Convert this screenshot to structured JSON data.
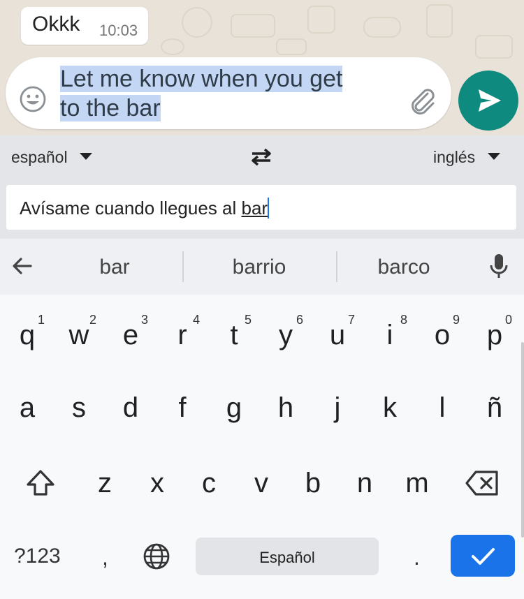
{
  "chat": {
    "message_text": "Okkk",
    "message_time": "10:03",
    "draft_line1": "Let me know when you get",
    "draft_line2": "to the bar"
  },
  "translate": {
    "source_language": "español",
    "target_language": "inglés",
    "translation_prefix": "Avísame cuando llegues al ",
    "translation_current_word": "bar"
  },
  "suggestions": [
    "bar",
    "barrio",
    "barco"
  ],
  "keyboard": {
    "row1": [
      {
        "letter": "q",
        "num": "1"
      },
      {
        "letter": "w",
        "num": "2"
      },
      {
        "letter": "e",
        "num": "3"
      },
      {
        "letter": "r",
        "num": "4"
      },
      {
        "letter": "t",
        "num": "5"
      },
      {
        "letter": "y",
        "num": "6"
      },
      {
        "letter": "u",
        "num": "7"
      },
      {
        "letter": "i",
        "num": "8"
      },
      {
        "letter": "o",
        "num": "9"
      },
      {
        "letter": "p",
        "num": "0"
      }
    ],
    "row2": [
      "a",
      "s",
      "d",
      "f",
      "g",
      "h",
      "j",
      "k",
      "l",
      "ñ"
    ],
    "row3": [
      "z",
      "x",
      "c",
      "v",
      "b",
      "n",
      "m"
    ],
    "symbols_label": "?123",
    "comma_label": ",",
    "space_label": "Español",
    "period_label": "."
  },
  "colors": {
    "send_button": "#0e8a7e",
    "enter_key": "#1a73e8",
    "selection": "#c3d7f4"
  },
  "icons": [
    "emoji-icon",
    "attach-icon",
    "send-icon",
    "swap-icon",
    "back-arrow-icon",
    "mic-icon",
    "shift-icon",
    "delete-icon",
    "globe-icon",
    "checkmark-icon"
  ]
}
